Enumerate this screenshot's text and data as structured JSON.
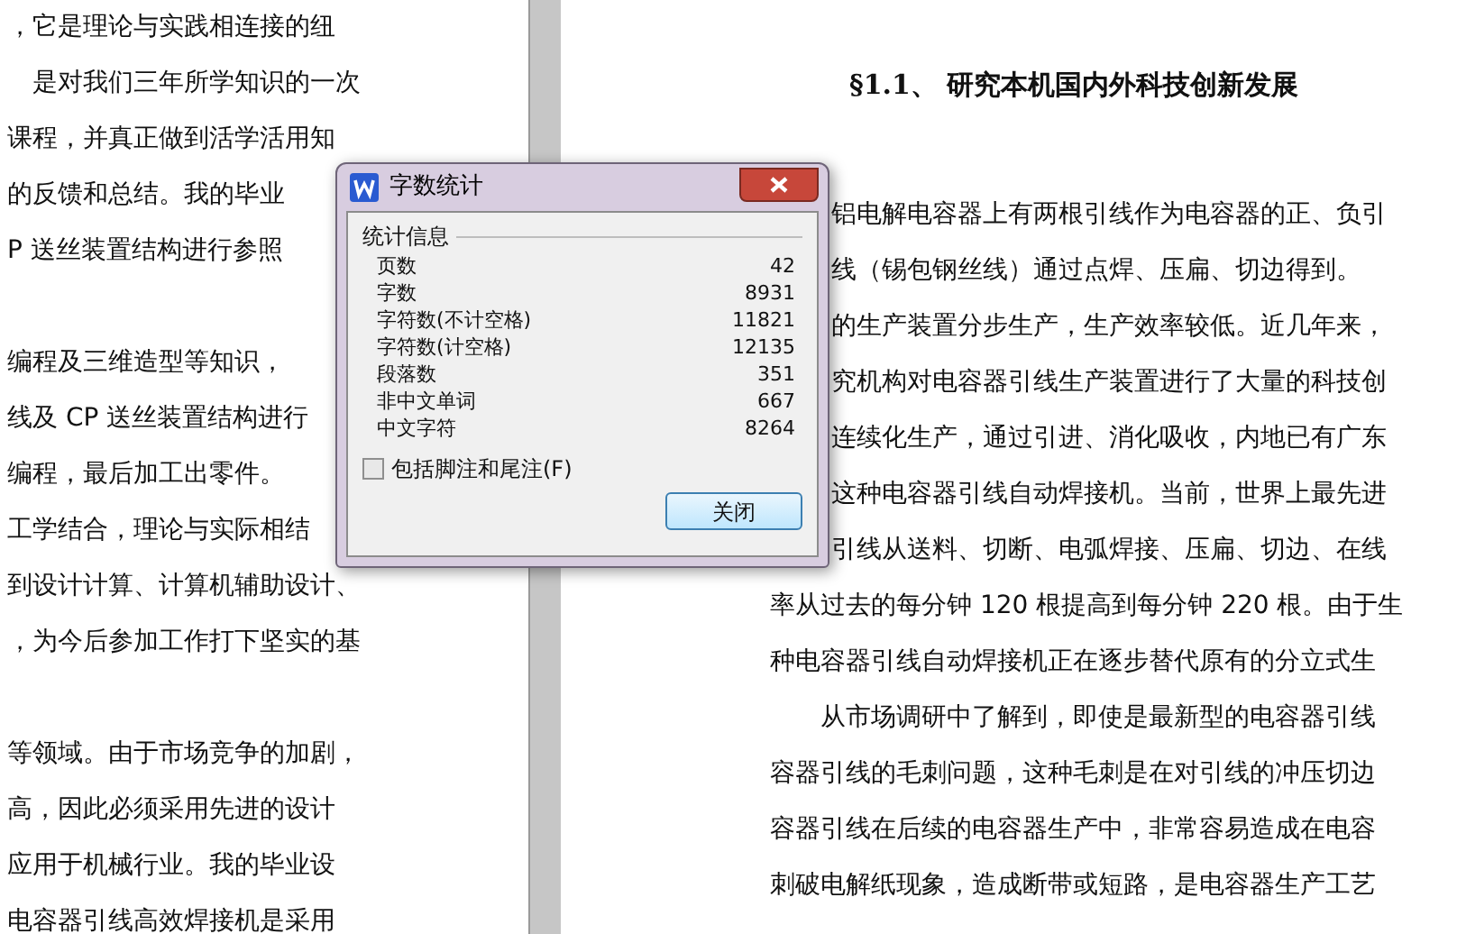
{
  "left_page": {
    "paragraphs": [
      [
        "，它是理论与实践相连接的纽",
        "　是对我们三年所学知识的一次",
        "课程，并真正做到活学活用知",
        "的反馈和总结。我的毕业",
        "P 送丝装置结构进行参照"
      ],
      [
        "编程及三维造型等知识，",
        "线及 CP 送丝装置结构进行",
        "编程，最后加工出零件。",
        "工学结合，理论与实际相结",
        "到设计计算、计算机辅助设计、",
        "，为今后参加工作打下坚实的基"
      ],
      [
        "等领域。由于市场竞争的加剧，",
        "高，因此必须采用先进的设计",
        "应用于机械行业。我的毕业设",
        "电容器引线高效焊接机是采用"
      ]
    ]
  },
  "right_page": {
    "heading": "§1.1、 研究本机国内外科技创新发展",
    "lines": [
      "铝电解电容器上有两根引线作为电容器的正、负引",
      "线（锡包钢丝线）通过点焊、压扁、切边得到。",
      "的生产装置分步生产，生产效率较低。近几年来，",
      "究机构对电容器引线生产装置进行了大量的科技创",
      "连续化生产，通过引进、消化吸收，内地已有广东",
      "这种电容器引线自动焊接机。当前，世界上最先进",
      "引线从送料、切断、电弧焊接、压扁、切边、在线",
      "率从过去的每分钟 120 根提高到每分钟 220 根。由于生",
      "种电容器引线自动焊接机正在逐步替代原有的分立式生",
      "　　从市场调研中了解到，即使是最新型的电容器引线",
      "容器引线的毛刺问题，这种毛刺是在对引线的冲压切边",
      "容器引线在后续的电容器生产中，非常容易造成在电容",
      "刺破电解纸现象，造成断带或短路，是电容器生产工艺"
    ]
  },
  "dialog": {
    "title": "字数统计",
    "group_label": "统计信息",
    "stats": [
      {
        "label": "页数",
        "value": "42"
      },
      {
        "label": "字数",
        "value": "8931"
      },
      {
        "label": "字符数(不计空格)",
        "value": "11821"
      },
      {
        "label": "字符数(计空格)",
        "value": "12135"
      },
      {
        "label": "段落数",
        "value": "351"
      },
      {
        "label": "非中文单词",
        "value": "667"
      },
      {
        "label": "中文字符",
        "value": "8264"
      }
    ],
    "checkbox": {
      "label": "包括脚注和尾注(F)",
      "checked": false
    },
    "close_button": "关闭"
  }
}
